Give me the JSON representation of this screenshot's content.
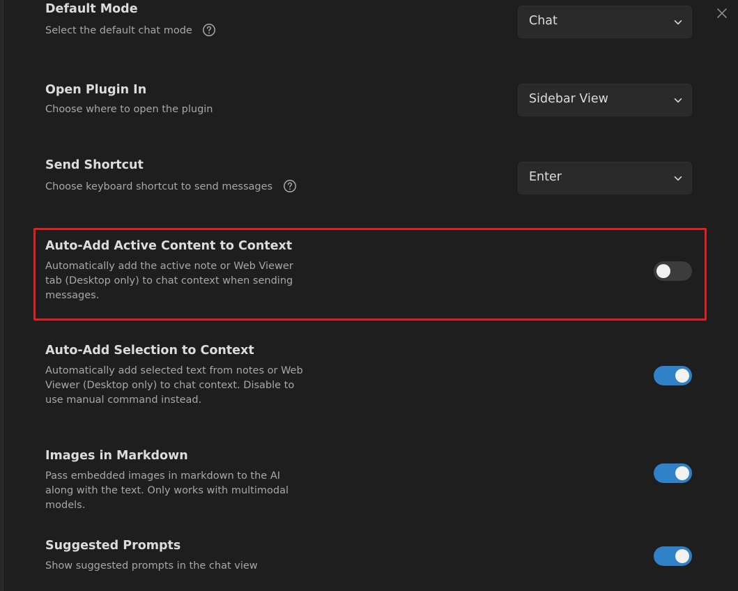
{
  "settings": {
    "default_mode": {
      "name": "Default Mode",
      "desc": "Select the default chat mode",
      "value": "Chat"
    },
    "open_plugin_in": {
      "name": "Open Plugin In",
      "desc": "Choose where to open the plugin",
      "value": "Sidebar View"
    },
    "send_shortcut": {
      "name": "Send Shortcut",
      "desc": "Choose keyboard shortcut to send messages",
      "value": "Enter"
    },
    "auto_add_active": {
      "name": "Auto-Add Active Content to Context",
      "desc": "Automatically add the active note or Web Viewer tab (Desktop only) to chat context when sending messages.",
      "enabled": false
    },
    "auto_add_selection": {
      "name": "Auto-Add Selection to Context",
      "desc": "Automatically add selected text from notes or Web Viewer (Desktop only) to chat context. Disable to use manual command instead.",
      "enabled": true
    },
    "images_in_markdown": {
      "name": "Images in Markdown",
      "desc": "Pass embedded images in markdown to the AI along with the text. Only works with multimodal models.",
      "enabled": true
    },
    "suggested_prompts": {
      "name": "Suggested Prompts",
      "desc": "Show suggested prompts in the chat view",
      "enabled": true
    }
  },
  "colors": {
    "background": "#1e1e1e",
    "toggle_on": "#2f81c8",
    "toggle_off": "#3c3c3c",
    "highlight": "#e02020"
  },
  "icons": {
    "close": "close-icon",
    "help": "help-circle-icon",
    "chevron": "chevron-down-icon"
  }
}
